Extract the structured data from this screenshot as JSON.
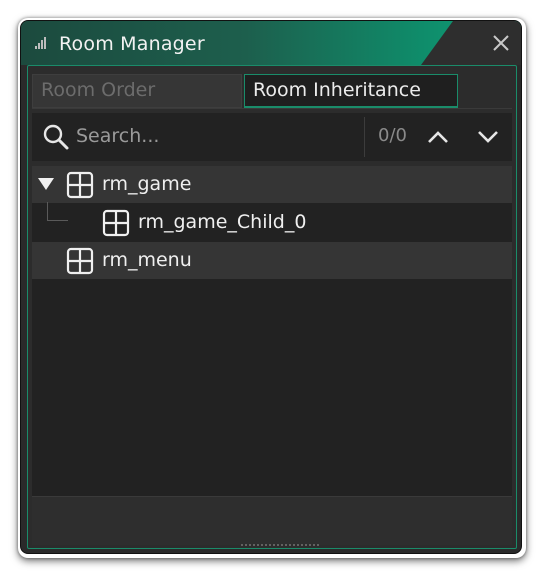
{
  "window": {
    "title": "Room Manager"
  },
  "tabs": [
    {
      "label": "Room Order",
      "active": false
    },
    {
      "label": "Room Inheritance",
      "active": true
    }
  ],
  "search": {
    "placeholder": "Search...",
    "value": "",
    "match_count": "0/0"
  },
  "tree": {
    "rows": [
      {
        "label": "rm_game",
        "icon": "room-icon",
        "expanded": true,
        "depth": 0
      },
      {
        "label": "rm_game_Child_0",
        "icon": "room-icon",
        "depth": 1
      },
      {
        "label": "rm_menu",
        "icon": "room-icon",
        "depth": 0
      }
    ]
  },
  "icons": {
    "grip": "grip-icon",
    "close": "close-icon",
    "search": "search-icon",
    "up": "chevron-up-icon",
    "down": "chevron-down-icon",
    "expand": "triangle-down-icon"
  },
  "colors": {
    "accent": "#1a8c6a",
    "title_gradient_start": "#1c4a3e",
    "title_gradient_end": "#10a07a",
    "panel_bg": "#222222",
    "row_highlight": "#353535"
  }
}
